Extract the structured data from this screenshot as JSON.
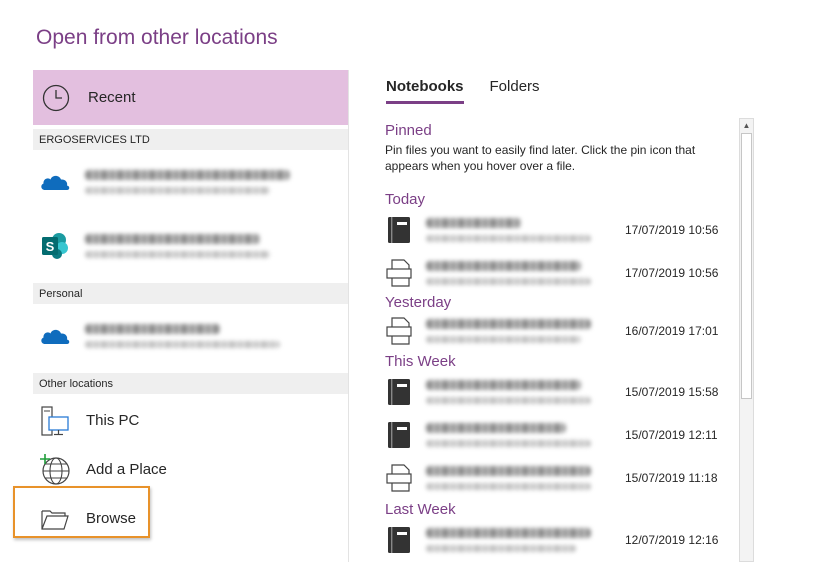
{
  "title": "Open from other locations",
  "left": {
    "recent": "Recent",
    "sections": {
      "org": "ERGOSERVICES LTD",
      "personal": "Personal",
      "other": "Other locations"
    },
    "locations": {
      "this_pc": "This PC",
      "add_place": "Add a Place",
      "browse": "Browse"
    }
  },
  "tabs": {
    "notebooks": "Notebooks",
    "folders": "Folders"
  },
  "right": {
    "pinned": "Pinned",
    "pinned_desc": "Pin files you want to easily find later. Click the pin icon that appears when you hover over a file.",
    "today": "Today",
    "yesterday": "Yesterday",
    "this_week": "This Week",
    "last_week": "Last Week",
    "dates": [
      "17/07/2019 10:56",
      "17/07/2019 10:56",
      "16/07/2019 17:01",
      "15/07/2019 15:58",
      "15/07/2019 12:11",
      "15/07/2019 11:18",
      "12/07/2019 12:16"
    ]
  },
  "colors": {
    "accent": "#7b3f86",
    "recent_bg": "#e3bfdf",
    "highlight": "#e8922a",
    "onedrive": "#0f6cbd"
  }
}
